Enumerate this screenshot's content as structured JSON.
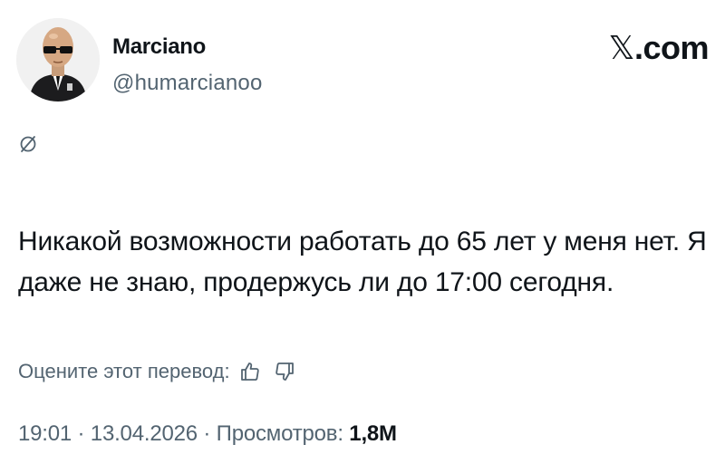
{
  "author": {
    "display_name": "Marciano",
    "handle": "@humarcianoo"
  },
  "brand": {
    "x_mark": "𝕏",
    "domain": ".com"
  },
  "tweet": {
    "text": "Никакой возможности работать до 65 лет у меня нет. Я даже не знаю, продержусь ли до 17:00 сегодня."
  },
  "translation_rating": {
    "label": "Оцените этот перевод:",
    "icons": [
      "thumbs-up-icon",
      "thumbs-down-icon"
    ]
  },
  "meta": {
    "time": "19:01",
    "separator": " · ",
    "date": "13.04.2026",
    "views_label": "Просмотров:",
    "views_count": "1,8M"
  },
  "colors": {
    "text_primary": "#0f1419",
    "text_secondary": "#536471",
    "background": "#ffffff"
  }
}
